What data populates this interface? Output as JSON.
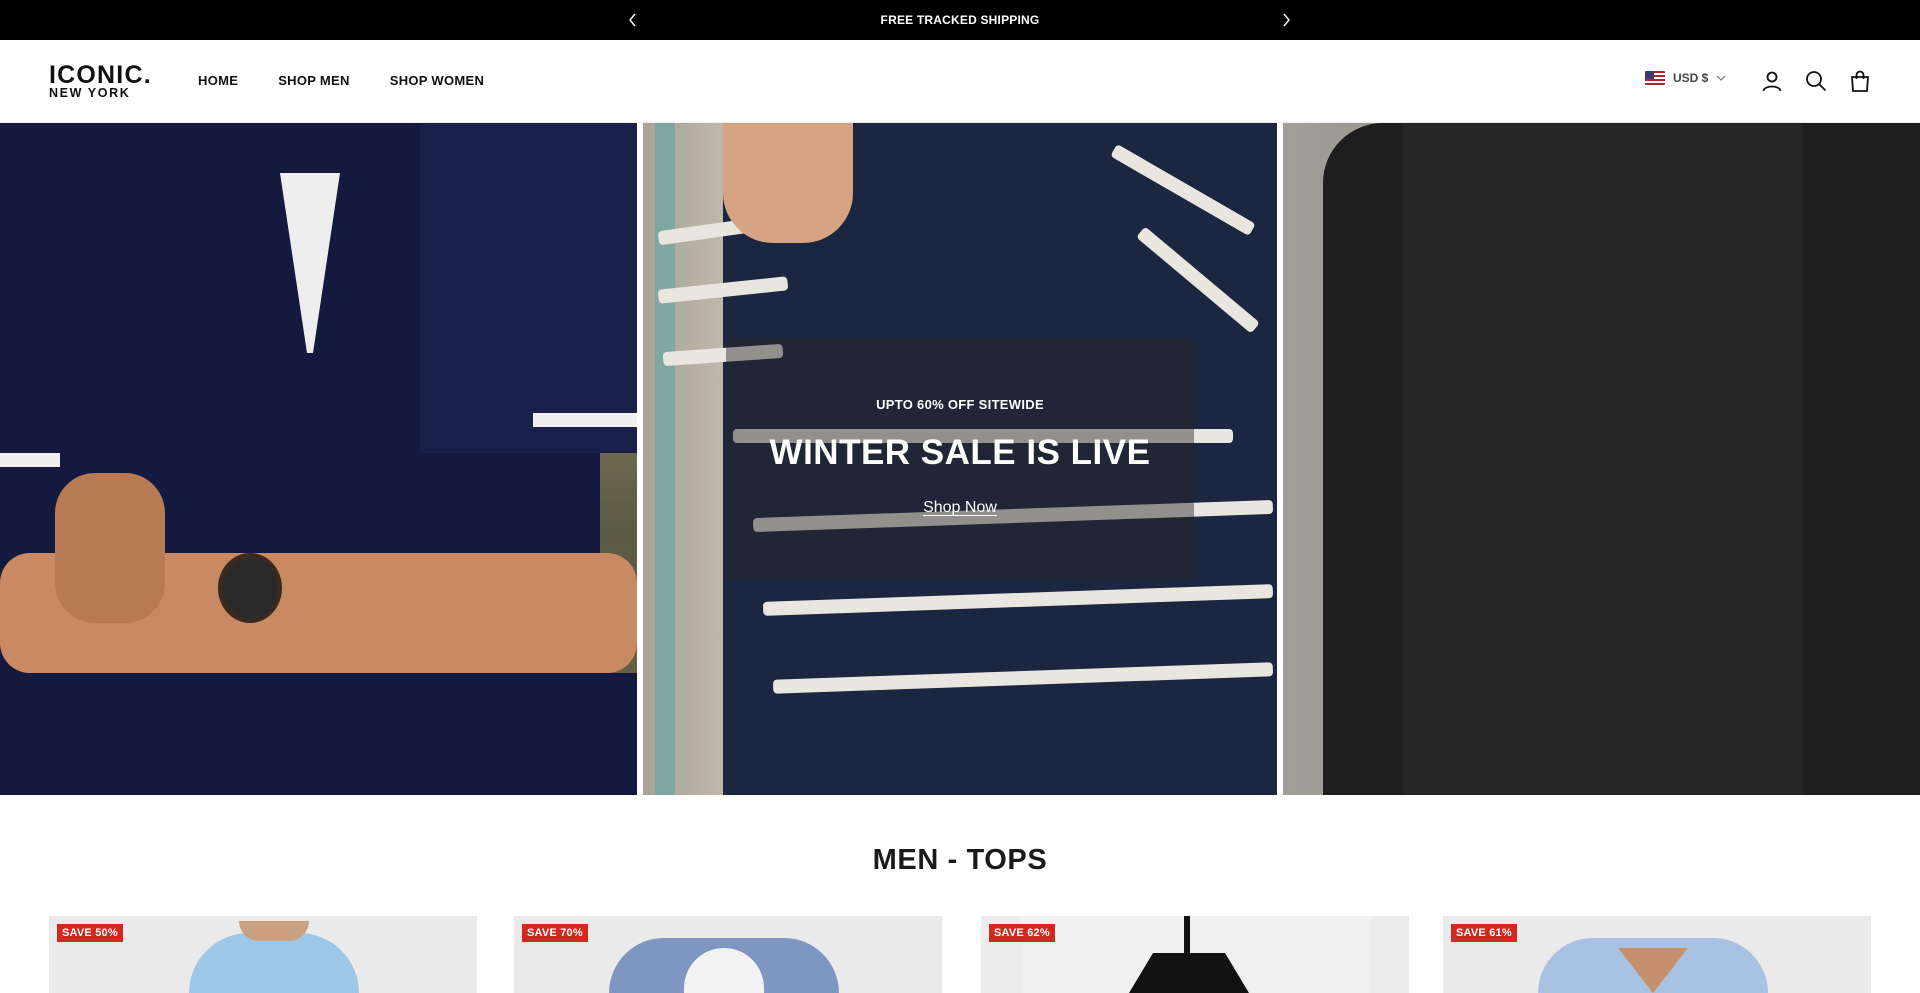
{
  "announcement": {
    "message": "FREE TRACKED SHIPPING",
    "prev_icon": "chevron-left-icon",
    "next_icon": "chevron-right-icon"
  },
  "header": {
    "logo": {
      "line1": "ICONIC.",
      "line2": "NEW YORK"
    },
    "nav": [
      {
        "label": "HOME"
      },
      {
        "label": "SHOP MEN"
      },
      {
        "label": "SHOP WOMEN"
      }
    ],
    "currency": {
      "label": "USD $",
      "flag": "us-flag-icon"
    },
    "icons": [
      "account-icon",
      "search-icon",
      "cart-icon"
    ]
  },
  "hero": {
    "subtitle": "UPTO 60% OFF SITEWIDE",
    "title": "WINTER SALE IS LIVE",
    "cta": "Shop Now"
  },
  "section": {
    "title": "MEN - TOPS",
    "products": [
      {
        "badge": "SAVE 50%"
      },
      {
        "badge": "SAVE 70%"
      },
      {
        "badge": "SAVE 62%"
      },
      {
        "badge": "SAVE 61%"
      }
    ]
  },
  "colors": {
    "announcement_bg": "#000000",
    "badge_red": "#d1281f",
    "text_dark": "#111111"
  }
}
